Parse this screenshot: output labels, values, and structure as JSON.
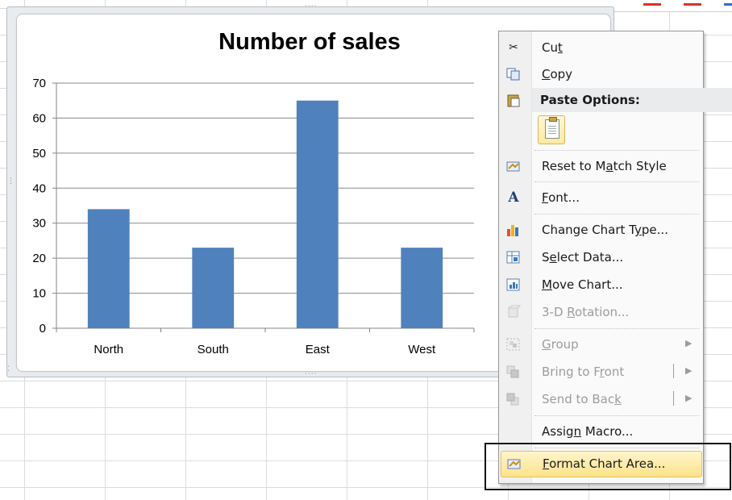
{
  "chart_data": {
    "type": "bar",
    "title": "Number of sales",
    "categories": [
      "North",
      "South",
      "East",
      "West"
    ],
    "values": [
      34,
      23,
      65,
      23
    ],
    "ylim": [
      0,
      70
    ],
    "yticks": [
      0,
      10,
      20,
      30,
      40,
      50,
      60,
      70
    ],
    "xlabel": "",
    "ylabel": "",
    "grid": true,
    "bar_color": "#4f81bd"
  },
  "context_menu": {
    "items": [
      {
        "id": "cut",
        "icon": "scissors-icon",
        "pre": "Cu",
        "acc": "t",
        "post": "",
        "disabled": false
      },
      {
        "id": "copy",
        "icon": "copy-icon",
        "pre": "",
        "acc": "C",
        "post": "opy",
        "disabled": false
      },
      {
        "id": "paste-options",
        "icon": "paste-icon",
        "pre": "Paste Options:",
        "acc": "",
        "post": "",
        "disabled": false
      },
      {
        "id": "reset-to-match-style",
        "icon": "reset-style-icon",
        "pre": "Reset to M",
        "acc": "a",
        "post": "tch Style",
        "disabled": false
      },
      {
        "id": "font",
        "icon": "font-icon",
        "pre": "",
        "acc": "F",
        "post": "ont...",
        "disabled": false
      },
      {
        "id": "change-chart-type",
        "icon": "chart-type-icon",
        "pre": "Change Chart T",
        "acc": "y",
        "post": "pe...",
        "disabled": false
      },
      {
        "id": "select-data",
        "icon": "select-data-icon",
        "pre": "S",
        "acc": "e",
        "post": "lect Data...",
        "disabled": false
      },
      {
        "id": "move-chart",
        "icon": "move-chart-icon",
        "pre": "",
        "acc": "M",
        "post": "ove Chart...",
        "disabled": false
      },
      {
        "id": "3d-rotation",
        "icon": "rotation-3d-icon",
        "pre": "3-D ",
        "acc": "R",
        "post": "otation...",
        "disabled": true
      },
      {
        "id": "group",
        "icon": "group-icon",
        "pre": "",
        "acc": "G",
        "post": "roup",
        "disabled": true
      },
      {
        "id": "bring-to-front",
        "icon": "bring-to-front-icon",
        "pre": "Bring to F",
        "acc": "r",
        "post": "ont",
        "disabled": true
      },
      {
        "id": "send-to-back",
        "icon": "send-to-back-icon",
        "pre": "Send to Bac",
        "acc": "k",
        "post": "",
        "disabled": true
      },
      {
        "id": "assign-macro",
        "icon": "",
        "pre": "Assig",
        "acc": "n",
        "post": " Macro...",
        "disabled": false
      },
      {
        "id": "format-chart-area",
        "icon": "format-chart-area-icon",
        "pre": "",
        "acc": "F",
        "post": "ormat Chart Area...",
        "disabled": false,
        "highlighted": true
      }
    ]
  },
  "colors": {
    "accent_highlight": "#ffe38a",
    "bar": "#4f81bd",
    "top_marks": [
      "#d9302c",
      "#d9302c",
      "#2a6fd6"
    ]
  }
}
